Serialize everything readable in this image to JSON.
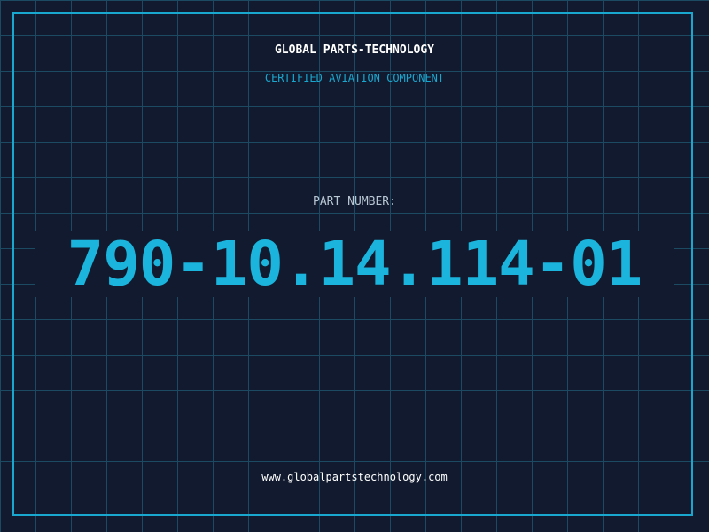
{
  "header": {
    "company": "GLOBAL PARTS-TECHNOLOGY",
    "subtitle": "CERTIFIED AVIATION COMPONENT"
  },
  "part": {
    "label": "PART NUMBER:",
    "number": "790-10.14.114-01"
  },
  "footer": {
    "website": "www.globalpartstechnology.com"
  },
  "colors": {
    "background": "#111a2e",
    "grid": "#1d4a63",
    "accent": "#1aa7cf",
    "part_number": "#1ab4dc"
  }
}
